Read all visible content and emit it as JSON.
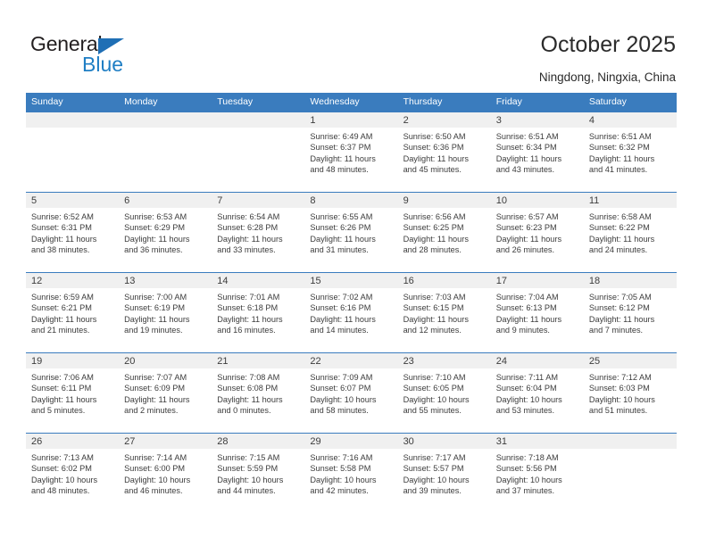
{
  "brand": {
    "name_top": "General",
    "name_bottom": "Blue",
    "accent_color": "#1f7ec4",
    "triangle_color": "#1f6fb5"
  },
  "header": {
    "title": "October 2025",
    "subtitle": "Ningdong, Ningxia, China"
  },
  "calendar": {
    "header_bg": "#3a7cbe",
    "daynum_bg": "#f0f0f0",
    "weekday_headers": [
      "Sunday",
      "Monday",
      "Tuesday",
      "Wednesday",
      "Thursday",
      "Friday",
      "Saturday"
    ],
    "weeks": [
      [
        null,
        null,
        null,
        {
          "day": "1",
          "sunrise": "Sunrise: 6:49 AM",
          "sunset": "Sunset: 6:37 PM",
          "daylight_line1": "Daylight: 11 hours",
          "daylight_line2": "and 48 minutes."
        },
        {
          "day": "2",
          "sunrise": "Sunrise: 6:50 AM",
          "sunset": "Sunset: 6:36 PM",
          "daylight_line1": "Daylight: 11 hours",
          "daylight_line2": "and 45 minutes."
        },
        {
          "day": "3",
          "sunrise": "Sunrise: 6:51 AM",
          "sunset": "Sunset: 6:34 PM",
          "daylight_line1": "Daylight: 11 hours",
          "daylight_line2": "and 43 minutes."
        },
        {
          "day": "4",
          "sunrise": "Sunrise: 6:51 AM",
          "sunset": "Sunset: 6:32 PM",
          "daylight_line1": "Daylight: 11 hours",
          "daylight_line2": "and 41 minutes."
        }
      ],
      [
        {
          "day": "5",
          "sunrise": "Sunrise: 6:52 AM",
          "sunset": "Sunset: 6:31 PM",
          "daylight_line1": "Daylight: 11 hours",
          "daylight_line2": "and 38 minutes."
        },
        {
          "day": "6",
          "sunrise": "Sunrise: 6:53 AM",
          "sunset": "Sunset: 6:29 PM",
          "daylight_line1": "Daylight: 11 hours",
          "daylight_line2": "and 36 minutes."
        },
        {
          "day": "7",
          "sunrise": "Sunrise: 6:54 AM",
          "sunset": "Sunset: 6:28 PM",
          "daylight_line1": "Daylight: 11 hours",
          "daylight_line2": "and 33 minutes."
        },
        {
          "day": "8",
          "sunrise": "Sunrise: 6:55 AM",
          "sunset": "Sunset: 6:26 PM",
          "daylight_line1": "Daylight: 11 hours",
          "daylight_line2": "and 31 minutes."
        },
        {
          "day": "9",
          "sunrise": "Sunrise: 6:56 AM",
          "sunset": "Sunset: 6:25 PM",
          "daylight_line1": "Daylight: 11 hours",
          "daylight_line2": "and 28 minutes."
        },
        {
          "day": "10",
          "sunrise": "Sunrise: 6:57 AM",
          "sunset": "Sunset: 6:23 PM",
          "daylight_line1": "Daylight: 11 hours",
          "daylight_line2": "and 26 minutes."
        },
        {
          "day": "11",
          "sunrise": "Sunrise: 6:58 AM",
          "sunset": "Sunset: 6:22 PM",
          "daylight_line1": "Daylight: 11 hours",
          "daylight_line2": "and 24 minutes."
        }
      ],
      [
        {
          "day": "12",
          "sunrise": "Sunrise: 6:59 AM",
          "sunset": "Sunset: 6:21 PM",
          "daylight_line1": "Daylight: 11 hours",
          "daylight_line2": "and 21 minutes."
        },
        {
          "day": "13",
          "sunrise": "Sunrise: 7:00 AM",
          "sunset": "Sunset: 6:19 PM",
          "daylight_line1": "Daylight: 11 hours",
          "daylight_line2": "and 19 minutes."
        },
        {
          "day": "14",
          "sunrise": "Sunrise: 7:01 AM",
          "sunset": "Sunset: 6:18 PM",
          "daylight_line1": "Daylight: 11 hours",
          "daylight_line2": "and 16 minutes."
        },
        {
          "day": "15",
          "sunrise": "Sunrise: 7:02 AM",
          "sunset": "Sunset: 6:16 PM",
          "daylight_line1": "Daylight: 11 hours",
          "daylight_line2": "and 14 minutes."
        },
        {
          "day": "16",
          "sunrise": "Sunrise: 7:03 AM",
          "sunset": "Sunset: 6:15 PM",
          "daylight_line1": "Daylight: 11 hours",
          "daylight_line2": "and 12 minutes."
        },
        {
          "day": "17",
          "sunrise": "Sunrise: 7:04 AM",
          "sunset": "Sunset: 6:13 PM",
          "daylight_line1": "Daylight: 11 hours",
          "daylight_line2": "and 9 minutes."
        },
        {
          "day": "18",
          "sunrise": "Sunrise: 7:05 AM",
          "sunset": "Sunset: 6:12 PM",
          "daylight_line1": "Daylight: 11 hours",
          "daylight_line2": "and 7 minutes."
        }
      ],
      [
        {
          "day": "19",
          "sunrise": "Sunrise: 7:06 AM",
          "sunset": "Sunset: 6:11 PM",
          "daylight_line1": "Daylight: 11 hours",
          "daylight_line2": "and 5 minutes."
        },
        {
          "day": "20",
          "sunrise": "Sunrise: 7:07 AM",
          "sunset": "Sunset: 6:09 PM",
          "daylight_line1": "Daylight: 11 hours",
          "daylight_line2": "and 2 minutes."
        },
        {
          "day": "21",
          "sunrise": "Sunrise: 7:08 AM",
          "sunset": "Sunset: 6:08 PM",
          "daylight_line1": "Daylight: 11 hours",
          "daylight_line2": "and 0 minutes."
        },
        {
          "day": "22",
          "sunrise": "Sunrise: 7:09 AM",
          "sunset": "Sunset: 6:07 PM",
          "daylight_line1": "Daylight: 10 hours",
          "daylight_line2": "and 58 minutes."
        },
        {
          "day": "23",
          "sunrise": "Sunrise: 7:10 AM",
          "sunset": "Sunset: 6:05 PM",
          "daylight_line1": "Daylight: 10 hours",
          "daylight_line2": "and 55 minutes."
        },
        {
          "day": "24",
          "sunrise": "Sunrise: 7:11 AM",
          "sunset": "Sunset: 6:04 PM",
          "daylight_line1": "Daylight: 10 hours",
          "daylight_line2": "and 53 minutes."
        },
        {
          "day": "25",
          "sunrise": "Sunrise: 7:12 AM",
          "sunset": "Sunset: 6:03 PM",
          "daylight_line1": "Daylight: 10 hours",
          "daylight_line2": "and 51 minutes."
        }
      ],
      [
        {
          "day": "26",
          "sunrise": "Sunrise: 7:13 AM",
          "sunset": "Sunset: 6:02 PM",
          "daylight_line1": "Daylight: 10 hours",
          "daylight_line2": "and 48 minutes."
        },
        {
          "day": "27",
          "sunrise": "Sunrise: 7:14 AM",
          "sunset": "Sunset: 6:00 PM",
          "daylight_line1": "Daylight: 10 hours",
          "daylight_line2": "and 46 minutes."
        },
        {
          "day": "28",
          "sunrise": "Sunrise: 7:15 AM",
          "sunset": "Sunset: 5:59 PM",
          "daylight_line1": "Daylight: 10 hours",
          "daylight_line2": "and 44 minutes."
        },
        {
          "day": "29",
          "sunrise": "Sunrise: 7:16 AM",
          "sunset": "Sunset: 5:58 PM",
          "daylight_line1": "Daylight: 10 hours",
          "daylight_line2": "and 42 minutes."
        },
        {
          "day": "30",
          "sunrise": "Sunrise: 7:17 AM",
          "sunset": "Sunset: 5:57 PM",
          "daylight_line1": "Daylight: 10 hours",
          "daylight_line2": "and 39 minutes."
        },
        {
          "day": "31",
          "sunrise": "Sunrise: 7:18 AM",
          "sunset": "Sunset: 5:56 PM",
          "daylight_line1": "Daylight: 10 hours",
          "daylight_line2": "and 37 minutes."
        },
        null
      ]
    ]
  }
}
